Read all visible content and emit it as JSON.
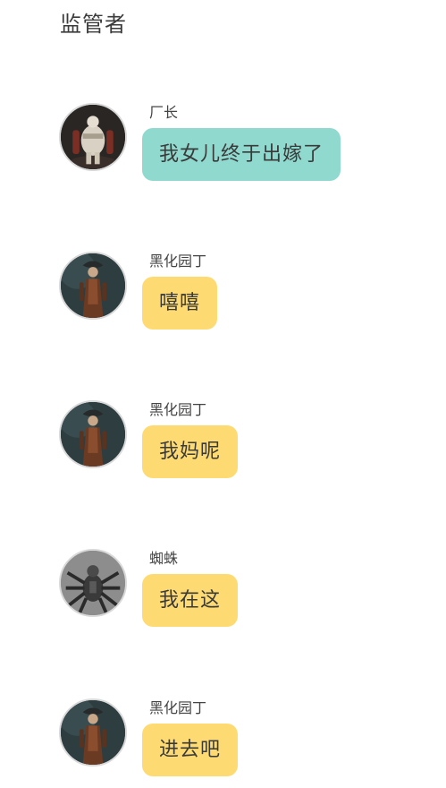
{
  "header": {
    "title": "监管者"
  },
  "messages": [
    {
      "sender": "厂长",
      "text": "我女儿终于出嫁了",
      "bubble_color": "#8fd9ce",
      "avatar": "factory-owner-avatar"
    },
    {
      "sender": "黑化园丁",
      "text": "嘻嘻",
      "bubble_color": "#fedb72",
      "avatar": "dark-gardener-avatar"
    },
    {
      "sender": "黑化园丁",
      "text": "我妈呢",
      "bubble_color": "#fedb72",
      "avatar": "dark-gardener-avatar"
    },
    {
      "sender": "蜘蛛",
      "text": "我在这",
      "bubble_color": "#fedb72",
      "avatar": "spider-avatar"
    },
    {
      "sender": "黑化园丁",
      "text": "进去吧",
      "bubble_color": "#fedb72",
      "avatar": "dark-gardener-avatar"
    }
  ]
}
